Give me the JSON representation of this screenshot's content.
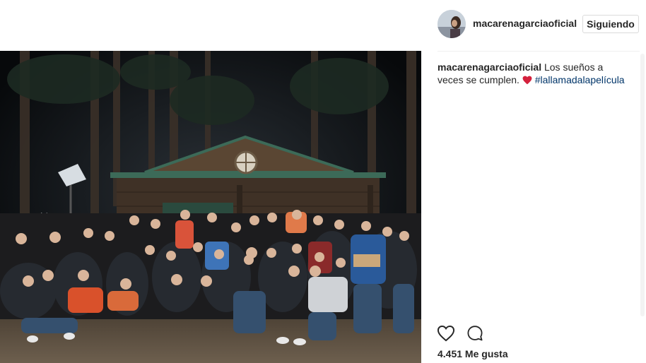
{
  "post": {
    "username": "macarenagarciaoficial",
    "follow_label": "Siguiendo",
    "caption": {
      "username": "macarenagarciaoficial",
      "text_line": "Los sueños a veces se cumplen.",
      "emoji": "heart-emoji",
      "hashtag": "#lallamadalapelícula"
    },
    "likes": "4.451 Me gusta",
    "actions": [
      "heart-icon",
      "comment-icon"
    ],
    "photo": {
      "subject": "group-photo"
    }
  },
  "colors": {
    "text": "#262626",
    "hashtag": "#003569",
    "border": "#dbdbdb",
    "heart_emoji": "#d4213d"
  }
}
